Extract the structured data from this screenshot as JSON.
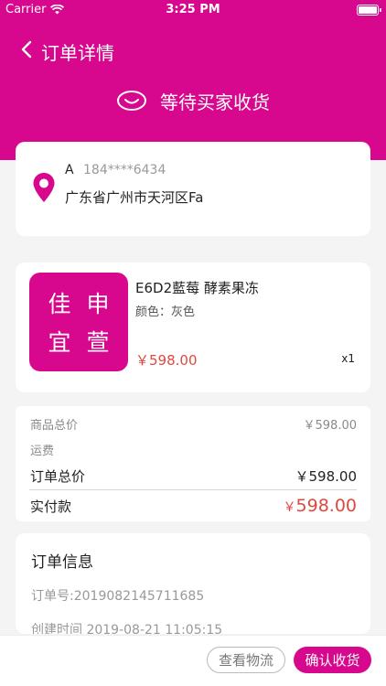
{
  "status_bar": {
    "carrier": "Carrier",
    "time": "3:25 PM"
  },
  "nav": {
    "title": "订单详情"
  },
  "order_state": {
    "label": "等待买家收货",
    "icon": "smile-face-icon"
  },
  "address": {
    "name": "A",
    "phone": "184****6434",
    "detail": "广东省广州市天河区Fa",
    "icon": "location-pin-icon"
  },
  "product": {
    "logo_chars": [
      "佳",
      "申",
      "宜",
      "萱"
    ],
    "name": "E6D2藍莓 酵素果冻",
    "spec": "颜色：灰色",
    "price": "￥598.00",
    "quantity": "x1"
  },
  "summary": {
    "goods_total_label": "商品总价",
    "goods_total_value": "￥598.00",
    "shipping_label": "运费",
    "order_total_label": "订单总价",
    "order_total_value": "￥598.00",
    "paid_label": "实付款",
    "paid_currency": "￥",
    "paid_amount": "598.00"
  },
  "order_info": {
    "title": "订单信息",
    "order_no": "订单号:2019082145711685",
    "created": "创建时间 2019-08-21 11:05:15"
  },
  "actions": {
    "track": "查看物流",
    "confirm": "确认收货"
  },
  "colors": {
    "brand": "#d8088e",
    "price": "#e0483f"
  }
}
